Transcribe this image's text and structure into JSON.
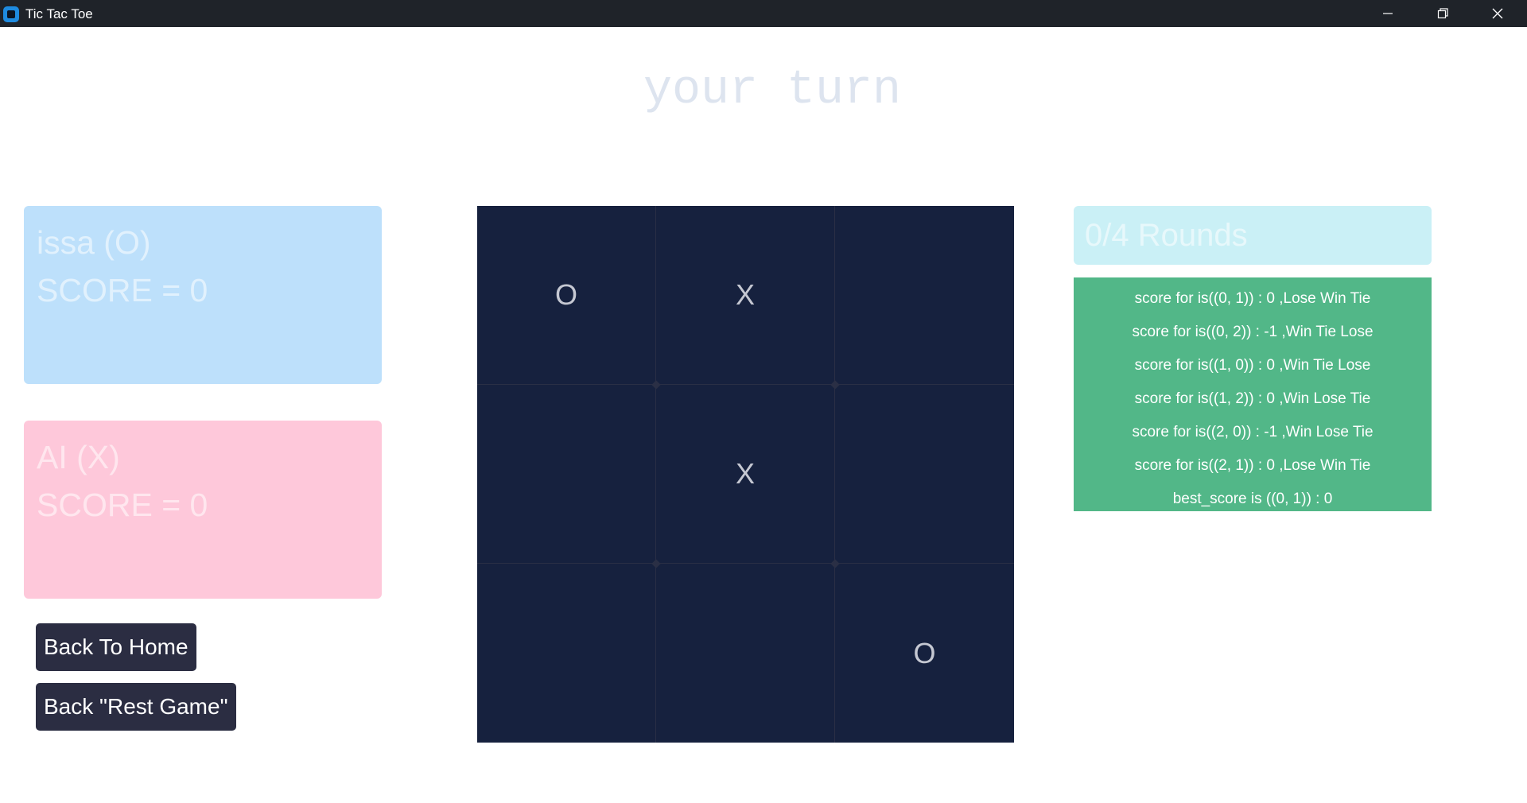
{
  "window": {
    "title": "Tic Tac Toe"
  },
  "turn_text": "your turn",
  "player1": {
    "name_line": "issa (O)",
    "score_line": "SCORE = 0"
  },
  "player2": {
    "name_line": "AI (X)",
    "score_line": "SCORE = 0"
  },
  "buttons": {
    "home": "Back To Home",
    "reset": "Back \"Rest Game\""
  },
  "board": [
    [
      "O",
      "X",
      ""
    ],
    [
      "",
      "X",
      ""
    ],
    [
      "",
      "",
      "O"
    ]
  ],
  "rounds_text": "0/4 Rounds",
  "scores": [
    "score for is((0, 1)) : 0 ,Lose Win Tie",
    "score for is((0, 2)) : -1 ,Win Tie Lose",
    "score for is((1, 0)) : 0 ,Win Tie Lose",
    "score for is((1, 2)) : 0 ,Win Lose Tie",
    "score for is((2, 0)) : -1 ,Win Lose Tie",
    "score for is((2, 1)) : 0 ,Lose Win Tie",
    "best_score is ((0, 1)) : 0"
  ],
  "colors": {
    "titlebar": "#1f2329",
    "board": "#16213e",
    "player1_card": "#bde0fb",
    "player2_card": "#fec8da",
    "rounds_panel": "#caf0f6",
    "scores_panel": "#52b788",
    "button": "#2b2d42"
  }
}
